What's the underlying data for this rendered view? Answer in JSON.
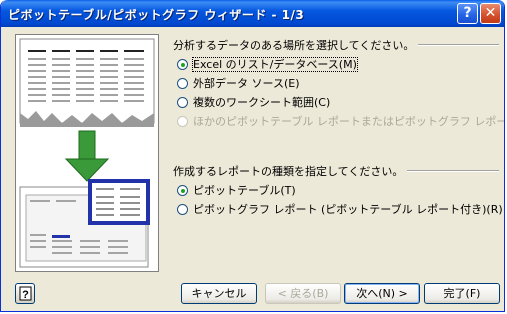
{
  "window": {
    "title": "ピボットテーブル/ピボットグラフ ウィザード - 1/3",
    "help_icon": "?",
    "close_icon": "✕"
  },
  "data_source": {
    "heading": "分析するデータのある場所を選択してください。",
    "options": [
      {
        "label": "Excel のリスト/データベース(M)",
        "checked": true,
        "enabled": true
      },
      {
        "label": "外部データ ソース(E)",
        "checked": false,
        "enabled": true
      },
      {
        "label": "複数のワークシート範囲(C)",
        "checked": false,
        "enabled": true
      },
      {
        "label": "ほかのピボットテーブル レポートまたはピボットグラフ レポート(A)",
        "checked": false,
        "enabled": false
      }
    ]
  },
  "report_type": {
    "heading": "作成するレポートの種類を指定してください。",
    "options": [
      {
        "label": "ピボットテーブル(T)",
        "checked": true,
        "enabled": true
      },
      {
        "label": "ピボットグラフ レポート (ピボットテーブル レポート付き)(R)",
        "checked": false,
        "enabled": true
      }
    ]
  },
  "buttons": {
    "cancel": "キャンセル",
    "back": "< 戻る(B)",
    "next": "次へ(N) >",
    "finish": "完了(F)"
  },
  "colors": {
    "titlebar": "#0558e0",
    "dialog_bg": "#ece9d8",
    "arrow": "#2e8b2e",
    "pivot_header": "#2233aa"
  }
}
